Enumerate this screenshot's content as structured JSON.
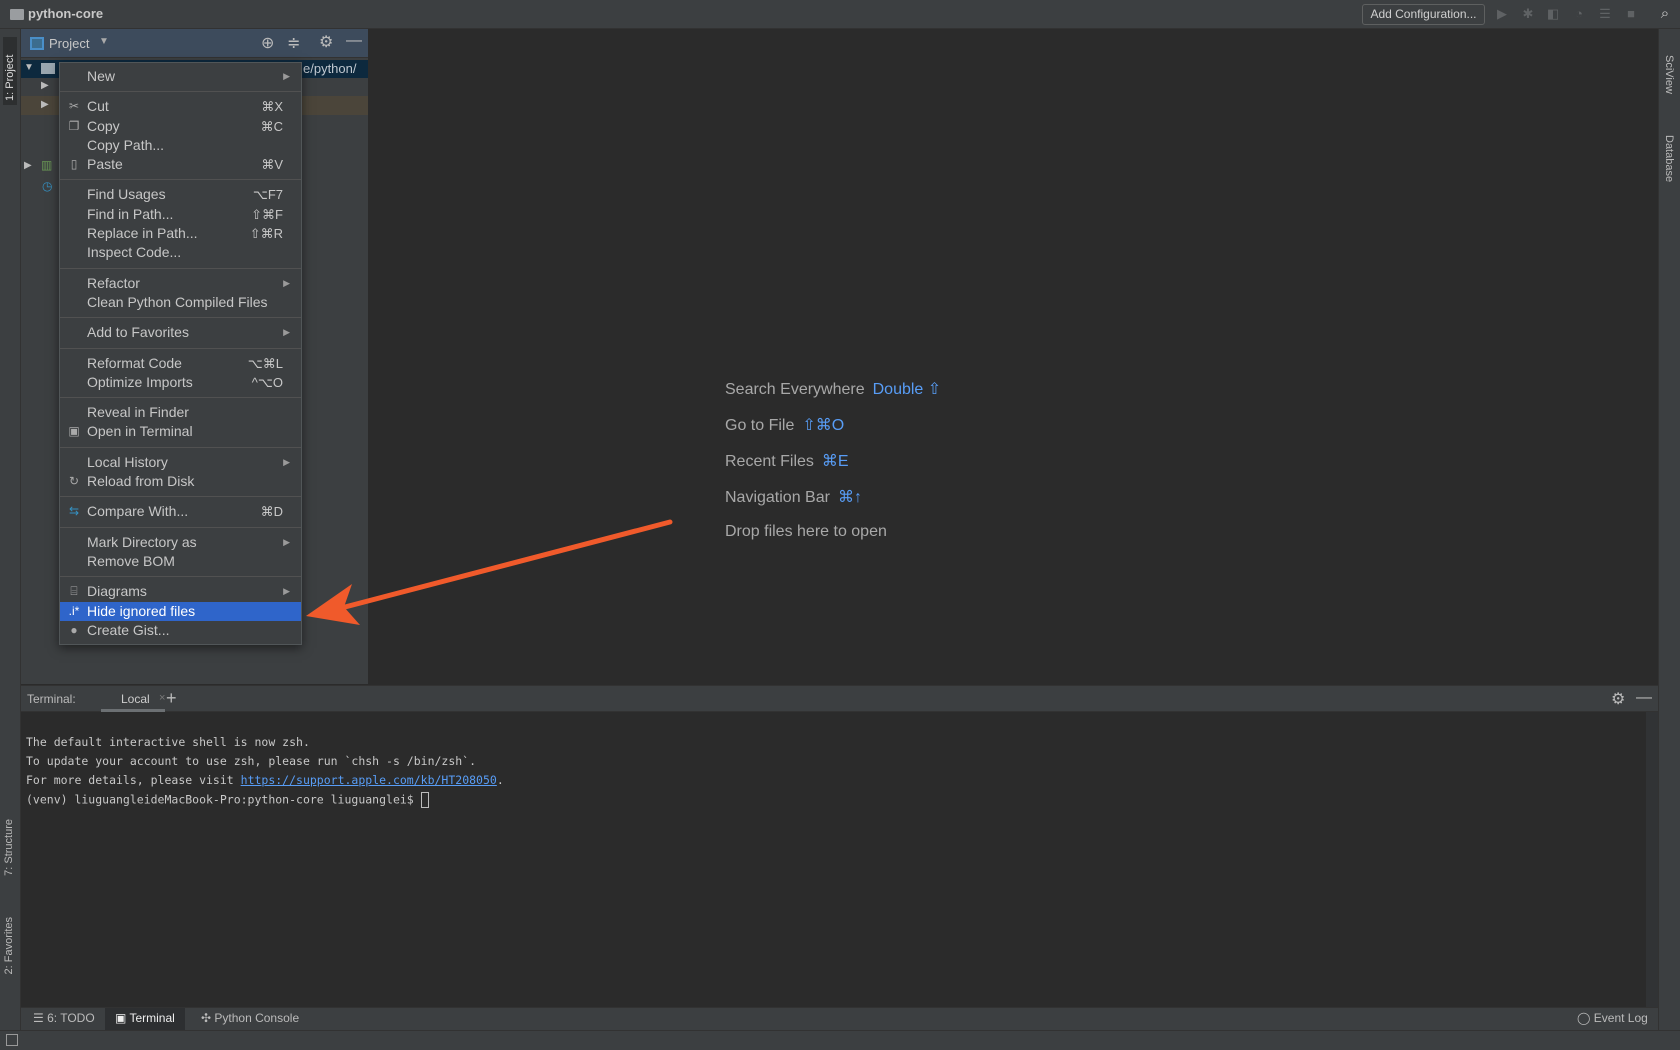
{
  "title_bar": {
    "project": "python-core",
    "add_configuration": "Add Configuration...",
    "icons": [
      "run-icon",
      "debug-icon",
      "coverage-icon",
      "profile-icon",
      "concurrency-icon",
      "stop-icon",
      "search-icon"
    ]
  },
  "left_tabs": {
    "project": "1: Project",
    "structure": "7: Structure",
    "favorites": "2: Favorites"
  },
  "right_tabs": {
    "sciview": "SciView",
    "database": "Database"
  },
  "project_panel": {
    "title": "Project",
    "path_fragment": "e/python/"
  },
  "context_menu": {
    "groups": [
      [
        {
          "label": "New",
          "submenu": true
        }
      ],
      [
        {
          "label": "Cut",
          "shortcut": "⌘X",
          "icon": "scissors-icon"
        },
        {
          "label": "Copy",
          "shortcut": "⌘C",
          "icon": "copy-icon"
        },
        {
          "label": "Copy Path..."
        },
        {
          "label": "Paste",
          "shortcut": "⌘V",
          "icon": "paste-icon"
        }
      ],
      [
        {
          "label": "Find Usages",
          "shortcut": "⌥F7"
        },
        {
          "label": "Find in Path...",
          "shortcut": "⇧⌘F"
        },
        {
          "label": "Replace in Path...",
          "shortcut": "⇧⌘R"
        },
        {
          "label": "Inspect Code..."
        }
      ],
      [
        {
          "label": "Refactor",
          "submenu": true
        },
        {
          "label": "Clean Python Compiled Files"
        }
      ],
      [
        {
          "label": "Add to Favorites",
          "submenu": true
        }
      ],
      [
        {
          "label": "Reformat Code",
          "shortcut": "⌥⌘L"
        },
        {
          "label": "Optimize Imports",
          "shortcut": "^⌥O"
        }
      ],
      [
        {
          "label": "Reveal in Finder"
        },
        {
          "label": "Open in Terminal",
          "icon": "terminal-icon"
        }
      ],
      [
        {
          "label": "Local History",
          "submenu": true
        },
        {
          "label": "Reload from Disk",
          "icon": "reload-icon"
        }
      ],
      [
        {
          "label": "Compare With...",
          "shortcut": "⌘D",
          "icon": "compare-icon"
        }
      ],
      [
        {
          "label": "Mark Directory as",
          "submenu": true
        },
        {
          "label": "Remove BOM"
        }
      ],
      [
        {
          "label": "Diagrams",
          "submenu": true,
          "icon": "diagram-icon"
        },
        {
          "label": "Hide ignored files",
          "icon": "regex-icon",
          "selected": true
        },
        {
          "label": "Create Gist...",
          "icon": "github-icon"
        }
      ]
    ]
  },
  "editor_hints": [
    {
      "label": "Search Everywhere",
      "key": "Double ⇧"
    },
    {
      "label": "Go to File",
      "key": "⇧⌘O"
    },
    {
      "label": "Recent Files",
      "key": "⌘E"
    },
    {
      "label": "Navigation Bar",
      "key": "⌘↑"
    },
    {
      "label": "Drop files here to open",
      "key": ""
    }
  ],
  "terminal": {
    "label": "Terminal:",
    "tab": "Local",
    "lines": [
      "The default interactive shell is now zsh.",
      "To update your account to use zsh, please run `chsh -s /bin/zsh`."
    ],
    "details_prefix": "For more details, please visit ",
    "link": "https://support.apple.com/kb/HT208050",
    "details_suffix": ".",
    "prompt": "(venv) liuguangleideMacBook-Pro:python-core liuguanglei$ "
  },
  "bottom_tabs": {
    "todo": "6: TODO",
    "terminal": "Terminal",
    "python_console": "Python Console",
    "event_log": "Event Log"
  },
  "colors": {
    "selection": "#2f65ca",
    "link": "#589df6",
    "arrow": "#f05a2b"
  }
}
